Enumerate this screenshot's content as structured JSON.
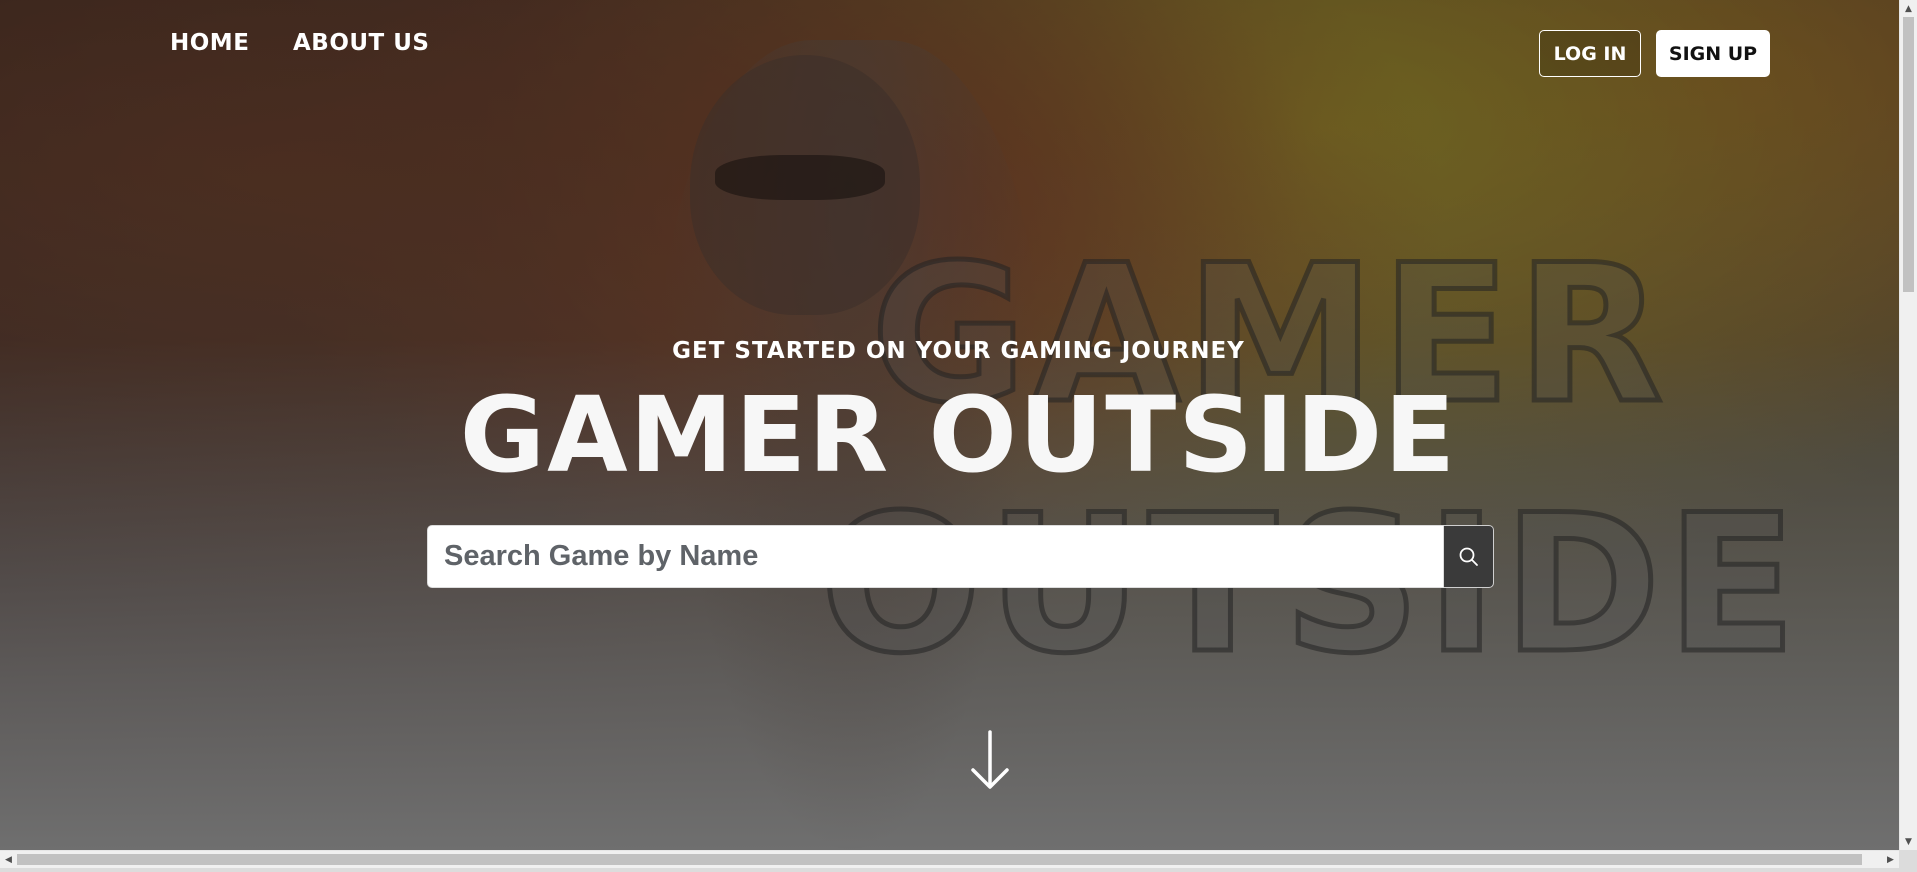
{
  "nav": {
    "home_label": "HOME",
    "about_label": "ABOUT US",
    "login_label": "LOG IN",
    "signup_label": "SIGN UP"
  },
  "hero": {
    "subtitle": "GET STARTED ON YOUR GAMING JOURNEY",
    "title": "GAMER OUTSIDE",
    "background_title": "GAMER\nOUTSIDE"
  },
  "search": {
    "placeholder": "Search Game by Name",
    "value": "",
    "icon": "search-icon"
  },
  "scroll_indicator": {
    "icon": "arrow-down-icon"
  },
  "colors": {
    "accent_text": "#ffffff",
    "search_button_bg": "#3a3a3a",
    "signup_bg": "#ffffff"
  }
}
